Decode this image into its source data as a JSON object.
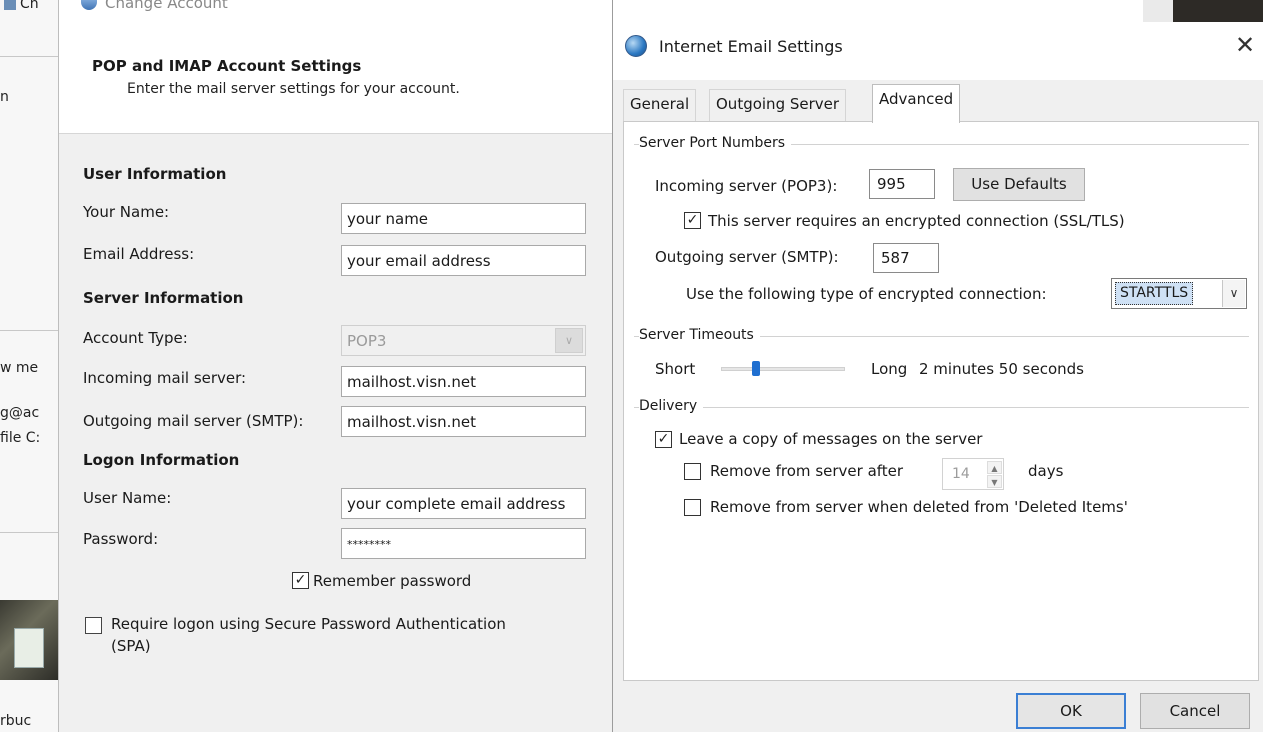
{
  "background": {
    "strip_texts": [
      "Ch",
      "n",
      "w me",
      "g@ac",
      "file C:",
      "rbuc"
    ]
  },
  "change_account": {
    "window_title": "Change Account",
    "header_title": "POP and IMAP Account Settings",
    "header_subtitle": "Enter the mail server settings for your account.",
    "user_info": {
      "heading": "User Information",
      "your_name_label": "Your Name:",
      "your_name_value": "your name",
      "email_label": "Email Address:",
      "email_value": "your email address"
    },
    "server_info": {
      "heading": "Server Information",
      "account_type_label": "Account Type:",
      "account_type_value": "POP3",
      "incoming_label": "Incoming mail server:",
      "incoming_value": "mailhost.visn.net",
      "outgoing_label": "Outgoing mail server (SMTP):",
      "outgoing_value": "mailhost.visn.net"
    },
    "logon_info": {
      "heading": "Logon Information",
      "username_label": "User Name:",
      "username_value": "your complete email address",
      "password_label": "Password:",
      "password_value": "********",
      "remember_label": "Remember password",
      "remember_checked": true,
      "spa_label_line1": "Require logon using Secure Password Authentication",
      "spa_label_line2": "(SPA)",
      "spa_checked": false
    }
  },
  "email_settings": {
    "window_title": "Internet Email Settings",
    "close_glyph": "✕",
    "tabs": [
      {
        "label": "General",
        "active": false
      },
      {
        "label": "Outgoing Server",
        "active": false
      },
      {
        "label": "Advanced",
        "active": true
      }
    ],
    "ports": {
      "group_label": "Server Port Numbers",
      "incoming_label": "Incoming server (POP3):",
      "incoming_value": "995",
      "use_defaults_label": "Use Defaults",
      "ssl_label": "This server requires an encrypted connection (SSL/TLS)",
      "ssl_checked": true,
      "outgoing_label": "Outgoing server (SMTP):",
      "outgoing_value": "587",
      "encrypt_label": "Use the following type of encrypted connection:",
      "encrypt_value": "STARTTLS"
    },
    "timeouts": {
      "group_label": "Server Timeouts",
      "short_label": "Short",
      "long_label": "Long",
      "value_text": "2 minutes 50 seconds",
      "slider_fraction": 0.28
    },
    "delivery": {
      "group_label": "Delivery",
      "leave_copy_label": "Leave a copy of messages on the server",
      "leave_copy_checked": true,
      "remove_after_label": "Remove from server after",
      "remove_after_checked": false,
      "remove_after_days": "14",
      "days_label": "days",
      "remove_deleted_label": "Remove from server when deleted from 'Deleted Items'",
      "remove_deleted_checked": false
    },
    "ok_label": "OK",
    "cancel_label": "Cancel"
  }
}
